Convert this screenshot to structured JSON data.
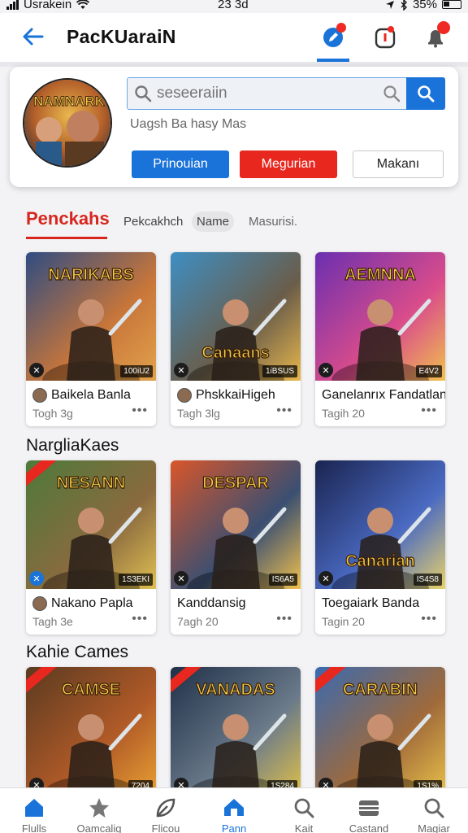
{
  "status_bar": {
    "carrier": "Usrakein",
    "time": "23 3d",
    "battery": "35%"
  },
  "header": {
    "title": "PacKUaraiN"
  },
  "profile": {
    "search_placeholder": "seseeraiin",
    "subtitle": "Uagsh Ba hasy Mas",
    "buttons": {
      "primary": "Prinouian",
      "danger": "Megurian",
      "outline": "Makanı"
    }
  },
  "tabs": [
    {
      "label": "Penckahs"
    },
    {
      "label": "Pekcakhch"
    },
    {
      "label": "Name"
    },
    {
      "label": "Masurisi."
    }
  ],
  "sections": [
    {
      "title": ""
    },
    {
      "title": "NargliaKaes"
    },
    {
      "title": "Kahie Cames"
    }
  ],
  "cards": [
    {
      "name": "Baikela Banla",
      "meta": "Togh 3g",
      "count": "100iU2",
      "art_text": "NARIKABS",
      "colors": [
        "#2f4c82",
        "#c8763a",
        "#e2a24b"
      ]
    },
    {
      "name": "PhskkaiHigeh",
      "meta": "Tagh 3lg",
      "count": "1iBSUS",
      "art_text": "Canaans",
      "colors": [
        "#3e8fc4",
        "#6a5d4a",
        "#e9b84d"
      ]
    },
    {
      "name": "Ganelanrıx Fandatlan",
      "meta": "Tagih 20",
      "count": "E4V2",
      "art_text": "AEMNNA",
      "colors": [
        "#6a2fb0",
        "#d94c8b",
        "#f2c14d"
      ]
    },
    {
      "name": "Nakano Papla",
      "meta": "Tagh 3e",
      "count": "1S3EKI",
      "art_text": "NESANN",
      "colors": [
        "#4d7a3a",
        "#8a6a3f",
        "#e0c052"
      ]
    },
    {
      "name": "Kanddansig",
      "meta": "7agh 20",
      "count": "IS6A5",
      "art_text": "DESPAR",
      "colors": [
        "#d9562a",
        "#3a4f72",
        "#f2c14d"
      ]
    },
    {
      "name": "Toegaiark Banda",
      "meta": "Tagin 20",
      "count": "IS4S8",
      "art_text": "Canarian",
      "colors": [
        "#1a2450",
        "#4a6ac2",
        "#e9d26a"
      ]
    },
    {
      "name": "",
      "meta": "",
      "count": "7204",
      "art_text": "CAMSE",
      "colors": [
        "#5a3a20",
        "#b05a28",
        "#e8a032"
      ]
    },
    {
      "name": "",
      "meta": "",
      "count": "1S284",
      "art_text": "VANADAS",
      "colors": [
        "#203048",
        "#6a7a8a",
        "#e0c04a"
      ]
    },
    {
      "name": "",
      "meta": "",
      "count": "1S1%",
      "art_text": "CARABIN",
      "colors": [
        "#3a6ab0",
        "#a06a3a",
        "#e8c04a"
      ]
    }
  ],
  "bottom_nav": [
    {
      "label": "Flulls",
      "icon": "home-icon"
    },
    {
      "label": "Oamcalig",
      "icon": "star-icon"
    },
    {
      "label": "Flicou",
      "icon": "leaf-icon"
    },
    {
      "label": "Pann",
      "icon": "house-active-icon"
    },
    {
      "label": "Kait",
      "icon": "search-icon"
    },
    {
      "label": "Castand",
      "icon": "wallet-icon"
    },
    {
      "label": "Magiar",
      "icon": "search-icon"
    }
  ],
  "colors": {
    "accent": "#1a73d9",
    "danger": "#e8271f",
    "tab_active": "#d7261e"
  }
}
